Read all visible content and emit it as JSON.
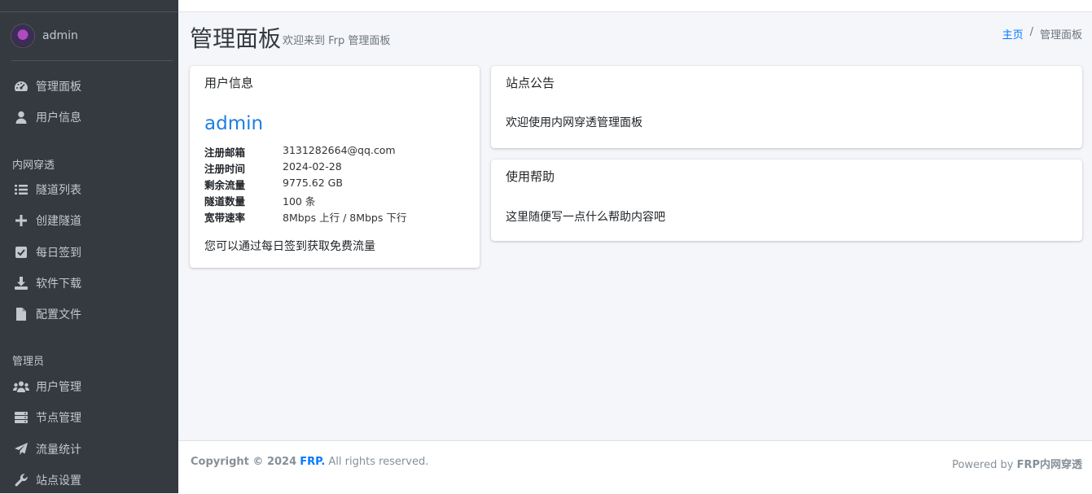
{
  "sidebar": {
    "user": {
      "name": "admin"
    },
    "items_main": [
      {
        "label": "管理面板",
        "icon": "dashboard-icon"
      },
      {
        "label": "用户信息",
        "icon": "user-icon"
      }
    ],
    "section_tunnel": "内网穿透",
    "items_tunnel": [
      {
        "label": "隧道列表",
        "icon": "list-icon"
      },
      {
        "label": "创建隧道",
        "icon": "plus-icon"
      },
      {
        "label": "每日签到",
        "icon": "check-square-icon"
      },
      {
        "label": "软件下载",
        "icon": "download-icon"
      },
      {
        "label": "配置文件",
        "icon": "file-icon"
      }
    ],
    "section_admin": "管理员",
    "items_admin": [
      {
        "label": "用户管理",
        "icon": "users-icon"
      },
      {
        "label": "节点管理",
        "icon": "server-icon"
      },
      {
        "label": "流量统计",
        "icon": "paper-plane-icon"
      },
      {
        "label": "站点设置",
        "icon": "wrench-icon"
      }
    ]
  },
  "header": {
    "title": "管理面板",
    "subtitle": "欢迎来到 Frp 管理面板",
    "breadcrumb": {
      "home": "主页",
      "separator": "/",
      "current": "管理面板"
    }
  },
  "user_card": {
    "title": "用户信息",
    "username": "admin",
    "rows": [
      {
        "label": "注册邮箱",
        "value": "3131282664@qq.com"
      },
      {
        "label": "注册时间",
        "value": "2024-02-28"
      },
      {
        "label": "剩余流量",
        "value": "9775.62 GB"
      },
      {
        "label": "隧道数量",
        "value": "100 条"
      },
      {
        "label": "宽带速率",
        "value": "8Mbps 上行 / 8Mbps 下行"
      }
    ],
    "note": "您可以通过每日签到获取免费流量"
  },
  "announcement_card": {
    "title": "站点公告",
    "text": "欢迎使用内网穿透管理面板"
  },
  "help_card": {
    "title": "使用帮助",
    "text": "这里随便写一点什么帮助内容吧"
  },
  "footer": {
    "copyright_prefix": "Copyright © 2024",
    "brand": "FRP.",
    "rights": "All rights reserved.",
    "powered_prefix": "Powered by",
    "powered_brand": "FRP内网穿透"
  },
  "colors": {
    "sidebar_bg": "#343a40",
    "accent": "#007bff",
    "content_bg": "#f4f6f9"
  }
}
